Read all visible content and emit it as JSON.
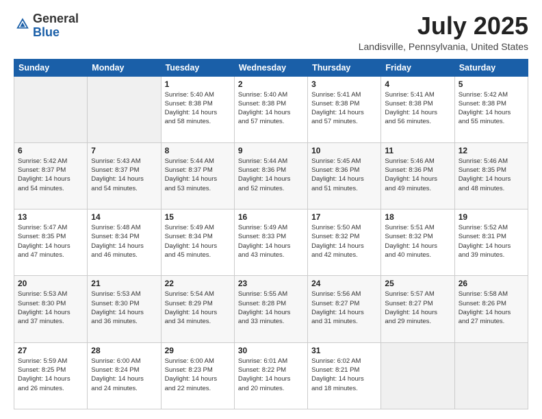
{
  "header": {
    "logo_general": "General",
    "logo_blue": "Blue",
    "month_title": "July 2025",
    "location": "Landisville, Pennsylvania, United States"
  },
  "columns": [
    "Sunday",
    "Monday",
    "Tuesday",
    "Wednesday",
    "Thursday",
    "Friday",
    "Saturday"
  ],
  "weeks": [
    [
      {
        "day": "",
        "detail": ""
      },
      {
        "day": "",
        "detail": ""
      },
      {
        "day": "1",
        "detail": "Sunrise: 5:40 AM\nSunset: 8:38 PM\nDaylight: 14 hours\nand 58 minutes."
      },
      {
        "day": "2",
        "detail": "Sunrise: 5:40 AM\nSunset: 8:38 PM\nDaylight: 14 hours\nand 57 minutes."
      },
      {
        "day": "3",
        "detail": "Sunrise: 5:41 AM\nSunset: 8:38 PM\nDaylight: 14 hours\nand 57 minutes."
      },
      {
        "day": "4",
        "detail": "Sunrise: 5:41 AM\nSunset: 8:38 PM\nDaylight: 14 hours\nand 56 minutes."
      },
      {
        "day": "5",
        "detail": "Sunrise: 5:42 AM\nSunset: 8:38 PM\nDaylight: 14 hours\nand 55 minutes."
      }
    ],
    [
      {
        "day": "6",
        "detail": "Sunrise: 5:42 AM\nSunset: 8:37 PM\nDaylight: 14 hours\nand 54 minutes."
      },
      {
        "day": "7",
        "detail": "Sunrise: 5:43 AM\nSunset: 8:37 PM\nDaylight: 14 hours\nand 54 minutes."
      },
      {
        "day": "8",
        "detail": "Sunrise: 5:44 AM\nSunset: 8:37 PM\nDaylight: 14 hours\nand 53 minutes."
      },
      {
        "day": "9",
        "detail": "Sunrise: 5:44 AM\nSunset: 8:36 PM\nDaylight: 14 hours\nand 52 minutes."
      },
      {
        "day": "10",
        "detail": "Sunrise: 5:45 AM\nSunset: 8:36 PM\nDaylight: 14 hours\nand 51 minutes."
      },
      {
        "day": "11",
        "detail": "Sunrise: 5:46 AM\nSunset: 8:36 PM\nDaylight: 14 hours\nand 49 minutes."
      },
      {
        "day": "12",
        "detail": "Sunrise: 5:46 AM\nSunset: 8:35 PM\nDaylight: 14 hours\nand 48 minutes."
      }
    ],
    [
      {
        "day": "13",
        "detail": "Sunrise: 5:47 AM\nSunset: 8:35 PM\nDaylight: 14 hours\nand 47 minutes."
      },
      {
        "day": "14",
        "detail": "Sunrise: 5:48 AM\nSunset: 8:34 PM\nDaylight: 14 hours\nand 46 minutes."
      },
      {
        "day": "15",
        "detail": "Sunrise: 5:49 AM\nSunset: 8:34 PM\nDaylight: 14 hours\nand 45 minutes."
      },
      {
        "day": "16",
        "detail": "Sunrise: 5:49 AM\nSunset: 8:33 PM\nDaylight: 14 hours\nand 43 minutes."
      },
      {
        "day": "17",
        "detail": "Sunrise: 5:50 AM\nSunset: 8:32 PM\nDaylight: 14 hours\nand 42 minutes."
      },
      {
        "day": "18",
        "detail": "Sunrise: 5:51 AM\nSunset: 8:32 PM\nDaylight: 14 hours\nand 40 minutes."
      },
      {
        "day": "19",
        "detail": "Sunrise: 5:52 AM\nSunset: 8:31 PM\nDaylight: 14 hours\nand 39 minutes."
      }
    ],
    [
      {
        "day": "20",
        "detail": "Sunrise: 5:53 AM\nSunset: 8:30 PM\nDaylight: 14 hours\nand 37 minutes."
      },
      {
        "day": "21",
        "detail": "Sunrise: 5:53 AM\nSunset: 8:30 PM\nDaylight: 14 hours\nand 36 minutes."
      },
      {
        "day": "22",
        "detail": "Sunrise: 5:54 AM\nSunset: 8:29 PM\nDaylight: 14 hours\nand 34 minutes."
      },
      {
        "day": "23",
        "detail": "Sunrise: 5:55 AM\nSunset: 8:28 PM\nDaylight: 14 hours\nand 33 minutes."
      },
      {
        "day": "24",
        "detail": "Sunrise: 5:56 AM\nSunset: 8:27 PM\nDaylight: 14 hours\nand 31 minutes."
      },
      {
        "day": "25",
        "detail": "Sunrise: 5:57 AM\nSunset: 8:27 PM\nDaylight: 14 hours\nand 29 minutes."
      },
      {
        "day": "26",
        "detail": "Sunrise: 5:58 AM\nSunset: 8:26 PM\nDaylight: 14 hours\nand 27 minutes."
      }
    ],
    [
      {
        "day": "27",
        "detail": "Sunrise: 5:59 AM\nSunset: 8:25 PM\nDaylight: 14 hours\nand 26 minutes."
      },
      {
        "day": "28",
        "detail": "Sunrise: 6:00 AM\nSunset: 8:24 PM\nDaylight: 14 hours\nand 24 minutes."
      },
      {
        "day": "29",
        "detail": "Sunrise: 6:00 AM\nSunset: 8:23 PM\nDaylight: 14 hours\nand 22 minutes."
      },
      {
        "day": "30",
        "detail": "Sunrise: 6:01 AM\nSunset: 8:22 PM\nDaylight: 14 hours\nand 20 minutes."
      },
      {
        "day": "31",
        "detail": "Sunrise: 6:02 AM\nSunset: 8:21 PM\nDaylight: 14 hours\nand 18 minutes."
      },
      {
        "day": "",
        "detail": ""
      },
      {
        "day": "",
        "detail": ""
      }
    ]
  ]
}
